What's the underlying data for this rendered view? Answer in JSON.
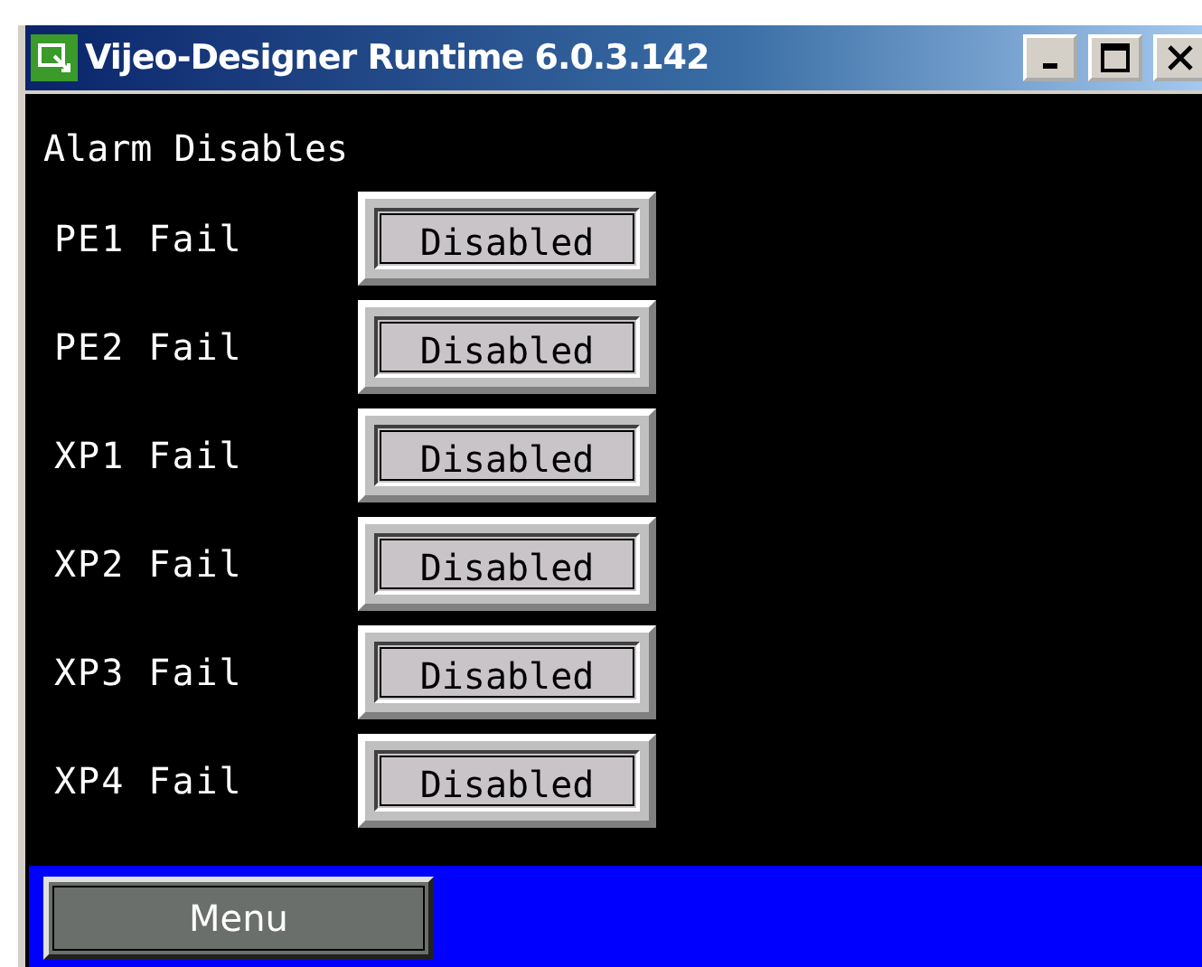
{
  "window": {
    "title": "Vijeo-Designer Runtime 6.0.3.142"
  },
  "screen": {
    "heading": "Alarm Disables",
    "rows": [
      {
        "label": "PE1 Fail",
        "button": "Disabled"
      },
      {
        "label": "PE2 Fail",
        "button": "Disabled"
      },
      {
        "label": "XP1 Fail",
        "button": "Disabled"
      },
      {
        "label": "XP2 Fail",
        "button": "Disabled"
      },
      {
        "label": "XP3 Fail",
        "button": "Disabled"
      },
      {
        "label": "XP4 Fail",
        "button": "Disabled"
      }
    ]
  },
  "footer": {
    "button": "Menu"
  }
}
